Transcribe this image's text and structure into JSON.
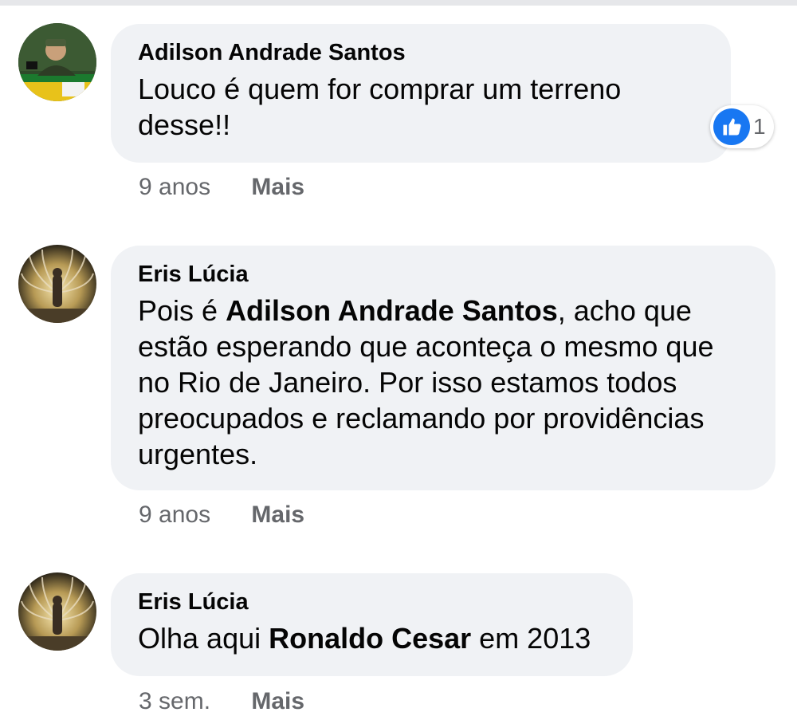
{
  "comments": [
    {
      "author": "Adilson Andrade Santos",
      "text_parts": [
        "Louco é quem for comprar um terreno desse!!"
      ],
      "reaction": {
        "icon": "like-icon",
        "count": "1"
      },
      "time": "9 anos",
      "more_label": "Mais"
    },
    {
      "author": "Eris Lúcia",
      "text_parts": [
        "Pois é ",
        "Adilson Andrade Santos",
        ", acho que estão esperando que aconteça o mesmo que no Rio de Janeiro. Por isso estamos todos preocupados e reclamando por providências urgentes."
      ],
      "time": "9 anos",
      "more_label": "Mais"
    },
    {
      "author": "Eris Lúcia",
      "text_parts": [
        "Olha aqui ",
        "Ronaldo Cesar",
        " em 2013"
      ],
      "time": "3 sem.",
      "more_label": "Mais"
    }
  ],
  "colors": {
    "bubble": "#f0f2f5",
    "meta_text": "#65676b",
    "like_blue": "#1877f2"
  }
}
